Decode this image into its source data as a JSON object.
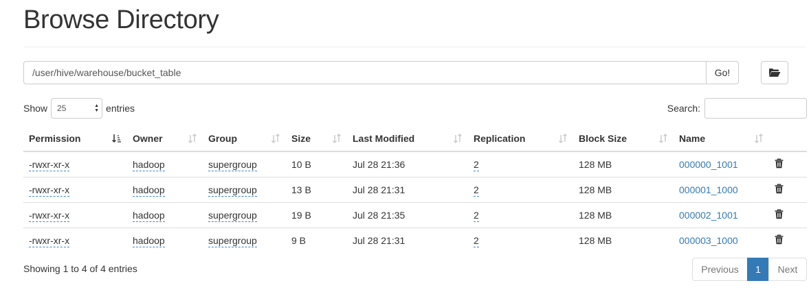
{
  "page": {
    "title": "Browse Directory"
  },
  "path_bar": {
    "value": "/user/hive/warehouse/bucket_table",
    "go_label": "Go!"
  },
  "length_control": {
    "show_label": "Show",
    "selected": "25",
    "entries_label": "entries"
  },
  "search": {
    "label": "Search:",
    "value": ""
  },
  "table": {
    "columns": [
      "Permission",
      "Owner",
      "Group",
      "Size",
      "Last Modified",
      "Replication",
      "Block Size",
      "Name"
    ],
    "sorted_column": "Permission",
    "rows": [
      {
        "permission": "-rwxr-xr-x",
        "owner": "hadoop",
        "group": "supergroup",
        "size": "10 B",
        "modified": "Jul 28 21:36",
        "replication": "2",
        "block_size": "128 MB",
        "name": "000000_1001"
      },
      {
        "permission": "-rwxr-xr-x",
        "owner": "hadoop",
        "group": "supergroup",
        "size": "13 B",
        "modified": "Jul 28 21:31",
        "replication": "2",
        "block_size": "128 MB",
        "name": "000001_1000"
      },
      {
        "permission": "-rwxr-xr-x",
        "owner": "hadoop",
        "group": "supergroup",
        "size": "19 B",
        "modified": "Jul 28 21:35",
        "replication": "2",
        "block_size": "128 MB",
        "name": "000002_1001"
      },
      {
        "permission": "-rwxr-xr-x",
        "owner": "hadoop",
        "group": "supergroup",
        "size": "9 B",
        "modified": "Jul 28 21:31",
        "replication": "2",
        "block_size": "128 MB",
        "name": "000003_1000"
      }
    ]
  },
  "footer": {
    "info": "Showing 1 to 4 of 4 entries",
    "pagination": {
      "previous": "Previous",
      "current": "1",
      "next": "Next"
    }
  },
  "icons": {
    "folder": "folder-open-icon",
    "delete": "trash-icon",
    "sort": "sort-icon"
  },
  "colors": {
    "link": "#337ab7",
    "active_page": "#337ab7",
    "dotted_underline": "#3a87c8"
  }
}
